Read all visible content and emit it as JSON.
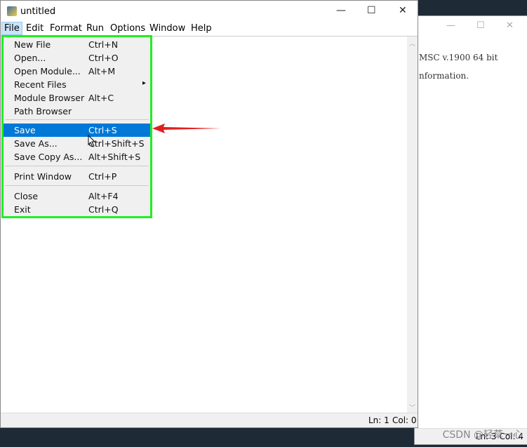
{
  "background_window": {
    "line1": "MSC v.1900 64 bit",
    "line2": "nformation.",
    "status": "Ln: 3  Col: 4"
  },
  "window": {
    "title": "untitled",
    "minimize": "—",
    "maximize": "☐",
    "close": "✕"
  },
  "menubar": [
    "File",
    "Edit",
    "Format",
    "Run",
    "Options",
    "Window",
    "Help"
  ],
  "file_menu": [
    {
      "label": "New File",
      "shortcut": "Ctrl+N"
    },
    {
      "label": "Open...",
      "shortcut": "Ctrl+O"
    },
    {
      "label": "Open Module...",
      "shortcut": "Alt+M"
    },
    {
      "label": "Recent Files",
      "shortcut": "▸"
    },
    {
      "label": "Module Browser",
      "shortcut": "Alt+C"
    },
    {
      "label": "Path Browser",
      "shortcut": ""
    },
    {
      "label": "Save",
      "shortcut": "Ctrl+S"
    },
    {
      "label": "Save As...",
      "shortcut": "Ctrl+Shift+S"
    },
    {
      "label": "Save Copy As...",
      "shortcut": "Alt+Shift+S"
    },
    {
      "label": "Print Window",
      "shortcut": "Ctrl+P"
    },
    {
      "label": "Close",
      "shortcut": "Alt+F4"
    },
    {
      "label": "Exit",
      "shortcut": "Ctrl+Q"
    }
  ],
  "status": {
    "ln": "Ln: 1",
    "col": "Col: 0"
  },
  "watermark": "CSDN @轻草一心",
  "colors": {
    "highlight": "#0078d7",
    "annotation_box": "#22ee22",
    "annotation_arrow": "#e02020"
  }
}
